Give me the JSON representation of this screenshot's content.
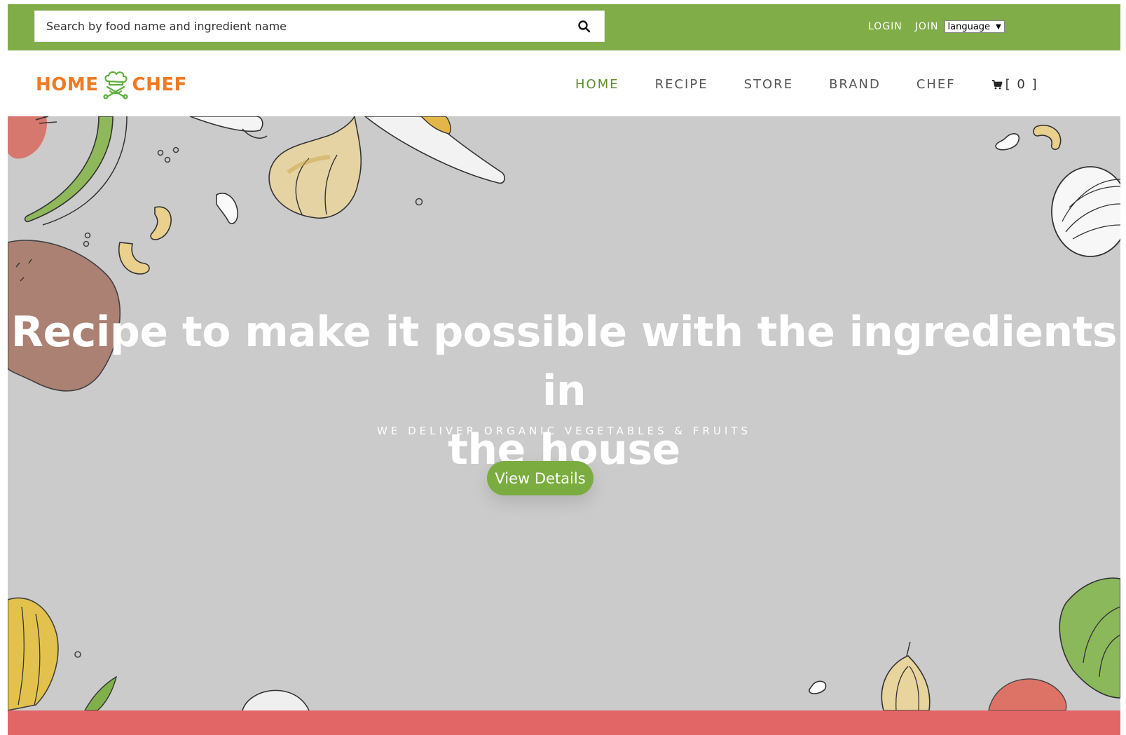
{
  "topbar": {
    "search_placeholder": "Search by food name and ingredient name",
    "login": "LOGIN",
    "join": "JOIN",
    "language": "language"
  },
  "logo": {
    "left": "HOME",
    "right": "CHEF"
  },
  "nav": {
    "items": [
      {
        "label": "HOME",
        "active": true
      },
      {
        "label": "RECIPE",
        "active": false
      },
      {
        "label": "STORE",
        "active": false
      },
      {
        "label": "BRAND",
        "active": false
      },
      {
        "label": "CHEF",
        "active": false
      }
    ],
    "cart_label": "[ 0 ]"
  },
  "hero": {
    "title_line1": "Recipe to make it possible with the ingredients in",
    "title_line2": "the house",
    "subtitle": "WE DELIVER ORGANIC VEGETABLES & FRUITS",
    "button": "View Details"
  },
  "colors": {
    "topbar": "#81ad49",
    "accent_green": "#7aac3f",
    "logo_orange": "#f07a22",
    "hero_bg": "#cbcbcb",
    "bottom_strip": "#e36666"
  },
  "icons": [
    "search-icon",
    "chef-hat-logo-icon",
    "cart-icon",
    "dropdown-arrow-icon"
  ]
}
